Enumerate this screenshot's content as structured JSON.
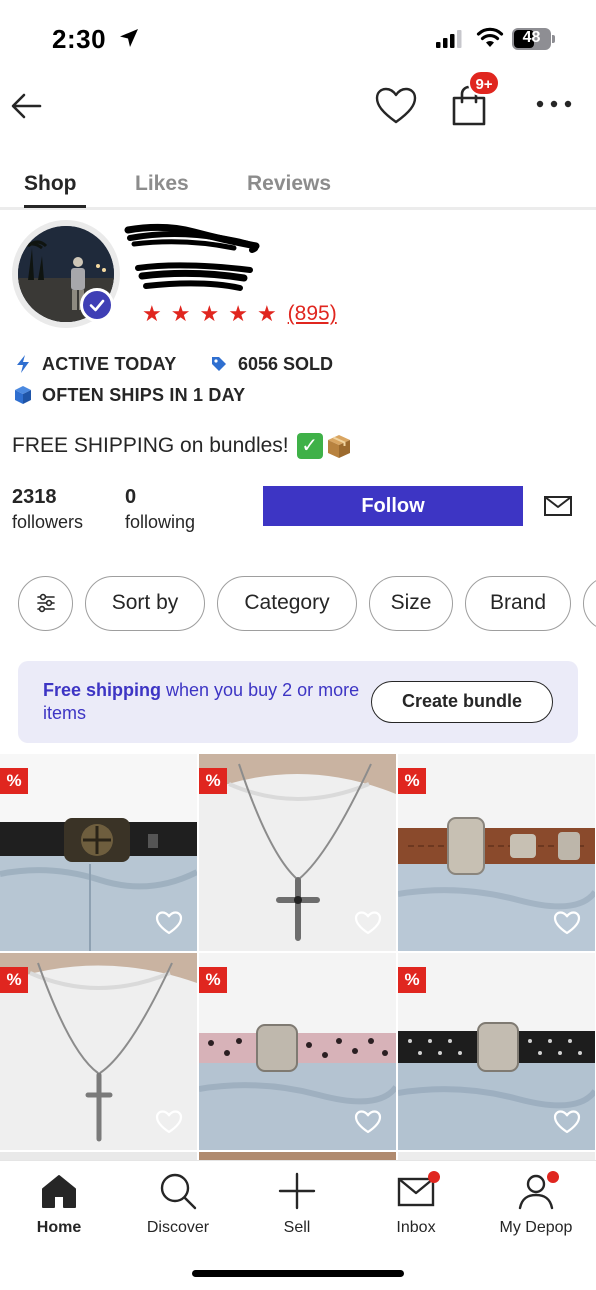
{
  "status_bar": {
    "time": "2:30",
    "battery_level": "48",
    "icons": [
      "location-arrow-icon",
      "cellular-signal-icon",
      "wifi-icon",
      "battery-icon"
    ]
  },
  "header": {
    "icons": [
      "back-arrow-icon",
      "heart-outline-icon",
      "shopping-bag-icon",
      "more-horizontal-icon"
    ],
    "bag_badge": "9+"
  },
  "tabs": [
    {
      "label": "Shop",
      "active": true
    },
    {
      "label": "Likes",
      "active": false
    },
    {
      "label": "Reviews",
      "active": false
    }
  ],
  "profile": {
    "verified": true,
    "rating_stars": 5,
    "review_count": "(895)",
    "badges": {
      "active": "ACTIVE TODAY",
      "sold": "6056 SOLD",
      "ships": "OFTEN SHIPS IN 1 DAY"
    },
    "bio": "FREE SHIPPING on bundles!",
    "bio_emojis": [
      "check-mark-emoji",
      "package-emoji"
    ],
    "followers_count": "2318",
    "followers_label": "followers",
    "following_count": "0",
    "following_label": "following",
    "follow_label": "Follow"
  },
  "filters": {
    "chips": [
      "Sort by",
      "Category",
      "Size",
      "Brand"
    ]
  },
  "promo": {
    "bold_text": "Free shipping",
    "rest_text": " when you buy 2 or more items",
    "button_label": "Create bundle"
  },
  "products": [
    {
      "item": "black-belt-cross-buckle",
      "badge": "%"
    },
    {
      "item": "cross-pendant-necklace",
      "badge": "%"
    },
    {
      "item": "brown-western-belt",
      "badge": "%"
    },
    {
      "item": "sword-pendant-necklace",
      "badge": "%"
    },
    {
      "item": "pink-leopard-studded-belt",
      "badge": "%"
    },
    {
      "item": "black-studded-western-belt",
      "badge": "%"
    }
  ],
  "bottom_nav": [
    {
      "label": "Home",
      "active": true
    },
    {
      "label": "Discover",
      "active": false
    },
    {
      "label": "Sell",
      "active": false
    },
    {
      "label": "Inbox",
      "active": false,
      "notification": true
    },
    {
      "label": "My Depop",
      "active": false,
      "notification": true
    }
  ],
  "colors": {
    "accent": "#3d35c4",
    "sale_red": "#e0261f",
    "promo_bg": "#ebebf8",
    "text": "#262626",
    "muted": "#8c8c8c"
  }
}
